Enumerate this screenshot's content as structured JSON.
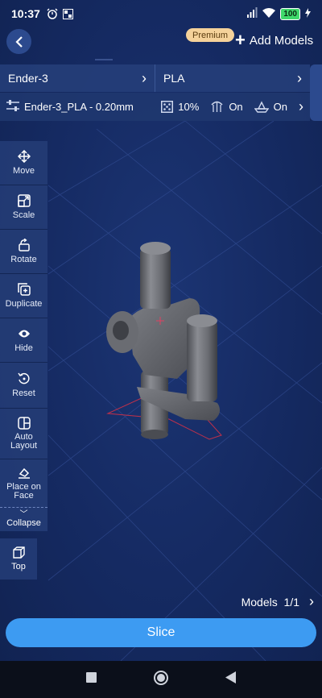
{
  "status": {
    "time": "10:37",
    "battery": "100"
  },
  "header": {
    "premium_badge": "Premium",
    "add_models_label": "Add Models"
  },
  "selector": {
    "printer": "Ender-3",
    "material": "PLA"
  },
  "profile": {
    "name": "Ender-3_PLA - 0.20mm",
    "infill": "10%",
    "support": "On",
    "adhesion": "On"
  },
  "toolbar": {
    "tools": [
      {
        "label": "Move",
        "icon": "move-icon"
      },
      {
        "label": "Scale",
        "icon": "scale-icon"
      },
      {
        "label": "Rotate",
        "icon": "rotate-icon"
      },
      {
        "label": "Duplicate",
        "icon": "duplicate-icon"
      },
      {
        "label": "Hide",
        "icon": "eye-icon"
      },
      {
        "label": "Reset",
        "icon": "reset-icon"
      },
      {
        "label": "Auto Layout",
        "icon": "auto-layout-icon"
      },
      {
        "label": "Place on Face",
        "icon": "place-on-face-icon"
      }
    ],
    "collapse_label": "Collapse",
    "top_view_label": "Top"
  },
  "models": {
    "label": "Models",
    "count": "1/1"
  },
  "slice_label": "Slice",
  "colors": {
    "background": "#14285c",
    "accent": "#3d9bf2",
    "premium": "#f5d29a",
    "panel": "#243c76"
  }
}
